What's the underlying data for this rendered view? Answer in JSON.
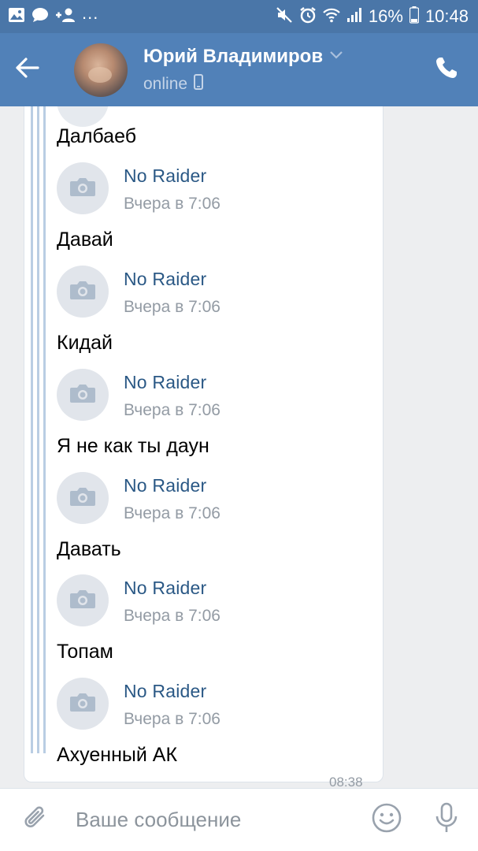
{
  "status_bar": {
    "left_icons": [
      "gallery-icon",
      "chat-bubble-icon",
      "add-person-icon"
    ],
    "more": "...",
    "right_icons": [
      "mute-icon",
      "alarm-icon",
      "wifi-icon",
      "signal-icon"
    ],
    "battery": "16%",
    "time": "10:48"
  },
  "header": {
    "name": "Юрий Владимиров",
    "status": "online",
    "colors": {
      "bar": "#5181b8",
      "status_bar": "#4a76a8"
    }
  },
  "chat": {
    "messages": [
      {
        "text": "Далбаеб"
      },
      {
        "forward_name": "No Raider",
        "forward_time": "Вчера в 7:06",
        "text": "Давай"
      },
      {
        "forward_name": "No Raider",
        "forward_time": "Вчера в 7:06",
        "text": "Кидай"
      },
      {
        "forward_name": "No Raider",
        "forward_time": "Вчера в 7:06",
        "text": "Я не как ты даун"
      },
      {
        "forward_name": "No Raider",
        "forward_time": "Вчера в 7:06",
        "text": "Давать"
      },
      {
        "forward_name": "No Raider",
        "forward_time": "Вчера в 7:06",
        "text": "Топам"
      },
      {
        "forward_name": "No Raider",
        "forward_time": "Вчера в 7:06",
        "text": "Ахуенный АК"
      }
    ],
    "time": "08:38",
    "colors": {
      "forward_name": "#2a5885",
      "forward_line": "#b9cde3"
    }
  },
  "input": {
    "placeholder": "Ваше сообщение",
    "value": ""
  }
}
